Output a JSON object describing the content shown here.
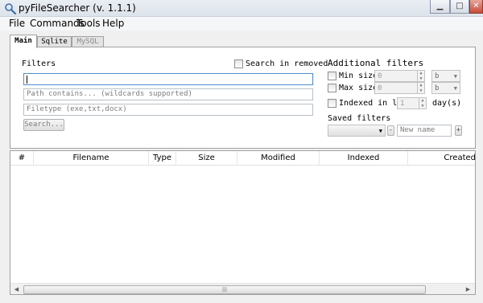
{
  "window": {
    "title": "pyFileSearcher (v. 1.1.1)",
    "minimize": "▁",
    "maximize": "□",
    "close": "✕"
  },
  "menu": [
    "File",
    "Commands",
    "Tools",
    "Help"
  ],
  "tabs": [
    "Main",
    "Sqlite",
    "MySQL"
  ],
  "filters": {
    "label": "Filters",
    "search_in_removed": "Search in removed",
    "name_value": "",
    "path_placeholder": "Path contains... (wildcards supported)",
    "filetype_placeholder": "Filetype (exe,txt,docx)",
    "search_button": "Search..."
  },
  "additional": {
    "label": "Additional filters",
    "min_size_label": "Min size:",
    "min_size_value": "0",
    "min_size_unit": "b",
    "max_size_label": "Max size:",
    "max_size_value": "0",
    "max_size_unit": "b",
    "indexed_label": "Indexed in last",
    "indexed_value": "1",
    "indexed_unit": "day(s)"
  },
  "saved": {
    "label": "Saved filters",
    "selected": "",
    "remove": "-",
    "name_placeholder": "New name",
    "add": "+"
  },
  "table": {
    "columns": [
      "#",
      "Filename",
      "Type",
      "Size",
      "Modified",
      "Indexed",
      "Created"
    ]
  }
}
